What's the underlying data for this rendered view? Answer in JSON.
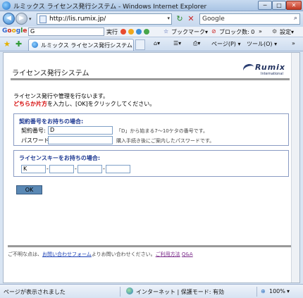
{
  "window": {
    "title": "ルミックス ライセンス発行システム - Windows Internet Explorer",
    "btn_min": "─",
    "btn_max": "□",
    "btn_close": "✕"
  },
  "address": {
    "url": "http://lis.rumix.jp/",
    "search_placeholder": "Google"
  },
  "google_toolbar": {
    "logo": [
      "G",
      "o",
      "o",
      "g",
      "l",
      "e"
    ],
    "input_value": "G",
    "execute": "実行",
    "bookmarks": "ブックマーク▾",
    "blocked": "ブロック数: 0",
    "more": "»",
    "settings": "設定▾"
  },
  "tab": {
    "label": "ルミックス ライセンス発行システム"
  },
  "commands": {
    "page": "ページ(P) ▾",
    "tools": "ツール(O) ▾",
    "more": "»"
  },
  "page": {
    "title": "ライセンス発行システム",
    "logo_name": "Rumix",
    "logo_sub": "International",
    "intro_line1": "ライセンス発行や管理を行ないます。",
    "intro_em": "どちらか片方",
    "intro_rest": "を入力し、[OK]をクリックしてください。",
    "contract_box": {
      "heading": "契約番号をお持ちの場合:",
      "contract_label": "契約番号:",
      "contract_value": "D",
      "contract_hint": "「D」から始まる7～10ケタの番号です。",
      "password_label": "パスワード:",
      "password_value": "",
      "password_hint": "購入手続き後にご案内したパスワードです。"
    },
    "license_box": {
      "heading": "ライセンスキーをお持ちの場合:",
      "key1": "K",
      "key2": "",
      "key3": "",
      "key4": "",
      "dash": "-"
    },
    "ok_button": "OK",
    "footer": {
      "prefix": "ご不明な点は、",
      "inquiry_link": "お問い合わせフォーム",
      "middle": "よりお問い合わせください。",
      "terms_link": "ご利用方法",
      "qa_link": "Q&A"
    }
  },
  "status": {
    "left": "ページが表示されました",
    "zone": "インターネット | 保護モード: 有効",
    "zoom": "100%"
  }
}
